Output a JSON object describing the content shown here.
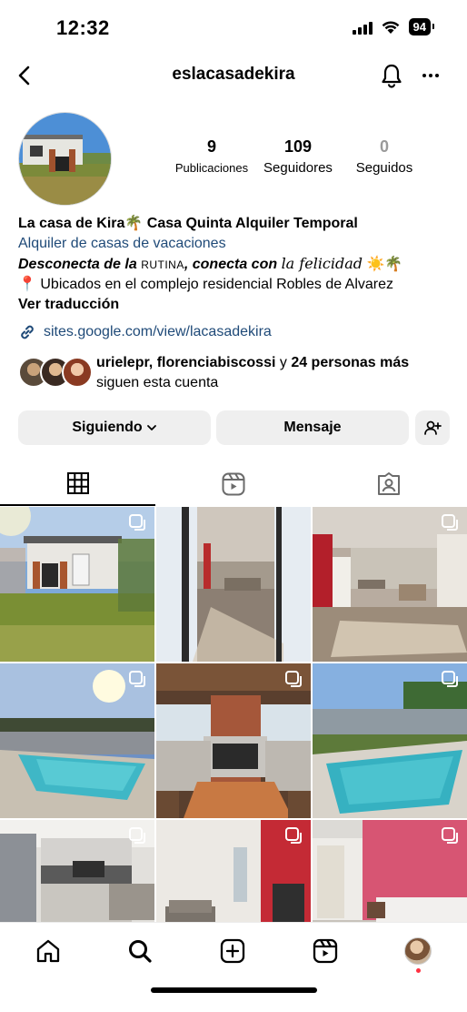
{
  "status_bar": {
    "time": "12:32",
    "battery": "94"
  },
  "header": {
    "username": "eslacasadekira"
  },
  "profile": {
    "stats": [
      {
        "value": "9",
        "label": "Publicaciones"
      },
      {
        "value": "109",
        "label": "Seguidores"
      },
      {
        "value": "0",
        "label": "Seguidos"
      }
    ]
  },
  "bio": {
    "name": "La casa de Kira",
    "name_emoji": "🌴",
    "name_suffix": " Casa Quinta Alquiler Temporal",
    "category": "Alquiler de casas de vacaciones",
    "tagline_part1": "Desconecta de la",
    "tagline_smallcaps": "RUTINA",
    "tagline_part2": ", conecta con",
    "tagline_script": "la felicidad",
    "tagline_emoji": "☀️🌴",
    "location_pin": "📍",
    "location": "Ubicados en el complejo residencial Robles de Alvarez",
    "translate": "Ver traducción"
  },
  "link": {
    "text": "sites.google.com/view/lacasadekira"
  },
  "followed_by": {
    "names": "urielepr, florenciabiscossi",
    "connector": " y ",
    "others": "24 personas más",
    "suffix": "siguen esta cuenta"
  },
  "actions": {
    "following_label": "Siguiendo",
    "message_label": "Mensaje"
  },
  "tabs": [
    {
      "icon": "grid-icon",
      "active": true
    },
    {
      "icon": "reels-icon",
      "active": false
    },
    {
      "icon": "tagged-icon",
      "active": false
    }
  ],
  "grid_posts": [
    {
      "scene": "house-exterior",
      "multi": true
    },
    {
      "scene": "living-room-doorway",
      "multi": false
    },
    {
      "scene": "living-room-red-wall",
      "multi": true
    },
    {
      "scene": "pool-sunset",
      "multi": true
    },
    {
      "scene": "barbecue-grill",
      "multi": true
    },
    {
      "scene": "pool-day",
      "multi": true
    },
    {
      "scene": "kitchen",
      "multi": true
    },
    {
      "scene": "living-room-sofa",
      "multi": true
    },
    {
      "scene": "bedroom-pink",
      "multi": true
    }
  ],
  "nav": [
    "home-icon",
    "search-icon",
    "create-icon",
    "reels-icon",
    "profile-avatar"
  ],
  "colors": {
    "link": "#1f4a78",
    "button_bg": "#efefef",
    "notification_dot": "#ff3040"
  }
}
